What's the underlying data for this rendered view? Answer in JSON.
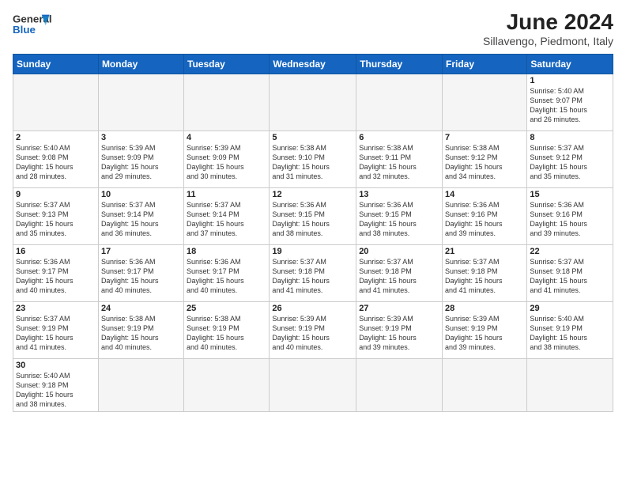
{
  "header": {
    "logo_general": "General",
    "logo_blue": "Blue",
    "month_title": "June 2024",
    "subtitle": "Sillavengo, Piedmont, Italy"
  },
  "weekdays": [
    "Sunday",
    "Monday",
    "Tuesday",
    "Wednesday",
    "Thursday",
    "Friday",
    "Saturday"
  ],
  "weeks": [
    [
      {
        "day": "",
        "info": ""
      },
      {
        "day": "",
        "info": ""
      },
      {
        "day": "",
        "info": ""
      },
      {
        "day": "",
        "info": ""
      },
      {
        "day": "",
        "info": ""
      },
      {
        "day": "",
        "info": ""
      },
      {
        "day": "1",
        "info": "Sunrise: 5:40 AM\nSunset: 9:07 PM\nDaylight: 15 hours\nand 26 minutes."
      }
    ],
    [
      {
        "day": "2",
        "info": "Sunrise: 5:40 AM\nSunset: 9:08 PM\nDaylight: 15 hours\nand 28 minutes."
      },
      {
        "day": "3",
        "info": "Sunrise: 5:39 AM\nSunset: 9:09 PM\nDaylight: 15 hours\nand 29 minutes."
      },
      {
        "day": "4",
        "info": "Sunrise: 5:39 AM\nSunset: 9:09 PM\nDaylight: 15 hours\nand 30 minutes."
      },
      {
        "day": "5",
        "info": "Sunrise: 5:38 AM\nSunset: 9:10 PM\nDaylight: 15 hours\nand 31 minutes."
      },
      {
        "day": "6",
        "info": "Sunrise: 5:38 AM\nSunset: 9:11 PM\nDaylight: 15 hours\nand 32 minutes."
      },
      {
        "day": "7",
        "info": "Sunrise: 5:38 AM\nSunset: 9:12 PM\nDaylight: 15 hours\nand 34 minutes."
      },
      {
        "day": "8",
        "info": "Sunrise: 5:37 AM\nSunset: 9:12 PM\nDaylight: 15 hours\nand 35 minutes."
      }
    ],
    [
      {
        "day": "9",
        "info": "Sunrise: 5:37 AM\nSunset: 9:13 PM\nDaylight: 15 hours\nand 35 minutes."
      },
      {
        "day": "10",
        "info": "Sunrise: 5:37 AM\nSunset: 9:14 PM\nDaylight: 15 hours\nand 36 minutes."
      },
      {
        "day": "11",
        "info": "Sunrise: 5:37 AM\nSunset: 9:14 PM\nDaylight: 15 hours\nand 37 minutes."
      },
      {
        "day": "12",
        "info": "Sunrise: 5:36 AM\nSunset: 9:15 PM\nDaylight: 15 hours\nand 38 minutes."
      },
      {
        "day": "13",
        "info": "Sunrise: 5:36 AM\nSunset: 9:15 PM\nDaylight: 15 hours\nand 38 minutes."
      },
      {
        "day": "14",
        "info": "Sunrise: 5:36 AM\nSunset: 9:16 PM\nDaylight: 15 hours\nand 39 minutes."
      },
      {
        "day": "15",
        "info": "Sunrise: 5:36 AM\nSunset: 9:16 PM\nDaylight: 15 hours\nand 39 minutes."
      }
    ],
    [
      {
        "day": "16",
        "info": "Sunrise: 5:36 AM\nSunset: 9:17 PM\nDaylight: 15 hours\nand 40 minutes."
      },
      {
        "day": "17",
        "info": "Sunrise: 5:36 AM\nSunset: 9:17 PM\nDaylight: 15 hours\nand 40 minutes."
      },
      {
        "day": "18",
        "info": "Sunrise: 5:36 AM\nSunset: 9:17 PM\nDaylight: 15 hours\nand 40 minutes."
      },
      {
        "day": "19",
        "info": "Sunrise: 5:37 AM\nSunset: 9:18 PM\nDaylight: 15 hours\nand 41 minutes."
      },
      {
        "day": "20",
        "info": "Sunrise: 5:37 AM\nSunset: 9:18 PM\nDaylight: 15 hours\nand 41 minutes."
      },
      {
        "day": "21",
        "info": "Sunrise: 5:37 AM\nSunset: 9:18 PM\nDaylight: 15 hours\nand 41 minutes."
      },
      {
        "day": "22",
        "info": "Sunrise: 5:37 AM\nSunset: 9:18 PM\nDaylight: 15 hours\nand 41 minutes."
      }
    ],
    [
      {
        "day": "23",
        "info": "Sunrise: 5:37 AM\nSunset: 9:19 PM\nDaylight: 15 hours\nand 41 minutes."
      },
      {
        "day": "24",
        "info": "Sunrise: 5:38 AM\nSunset: 9:19 PM\nDaylight: 15 hours\nand 40 minutes."
      },
      {
        "day": "25",
        "info": "Sunrise: 5:38 AM\nSunset: 9:19 PM\nDaylight: 15 hours\nand 40 minutes."
      },
      {
        "day": "26",
        "info": "Sunrise: 5:39 AM\nSunset: 9:19 PM\nDaylight: 15 hours\nand 40 minutes."
      },
      {
        "day": "27",
        "info": "Sunrise: 5:39 AM\nSunset: 9:19 PM\nDaylight: 15 hours\nand 39 minutes."
      },
      {
        "day": "28",
        "info": "Sunrise: 5:39 AM\nSunset: 9:19 PM\nDaylight: 15 hours\nand 39 minutes."
      },
      {
        "day": "29",
        "info": "Sunrise: 5:40 AM\nSunset: 9:19 PM\nDaylight: 15 hours\nand 38 minutes."
      }
    ],
    [
      {
        "day": "30",
        "info": "Sunrise: 5:40 AM\nSunset: 9:18 PM\nDaylight: 15 hours\nand 38 minutes."
      },
      {
        "day": "",
        "info": ""
      },
      {
        "day": "",
        "info": ""
      },
      {
        "day": "",
        "info": ""
      },
      {
        "day": "",
        "info": ""
      },
      {
        "day": "",
        "info": ""
      },
      {
        "day": "",
        "info": ""
      }
    ]
  ]
}
